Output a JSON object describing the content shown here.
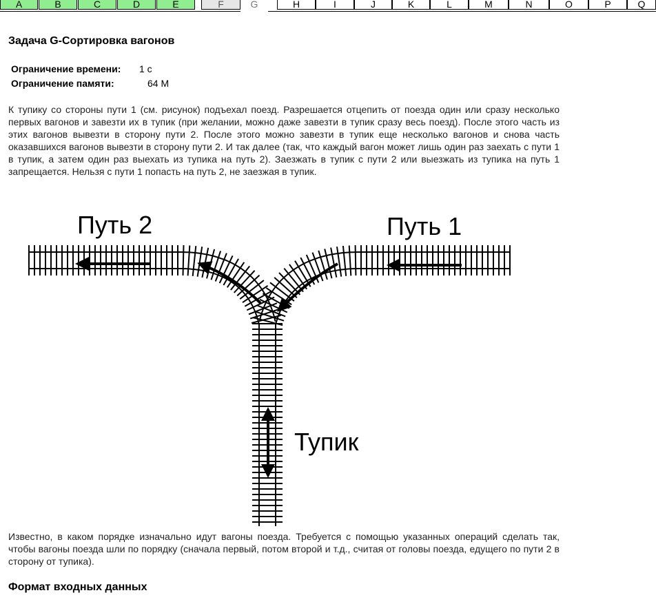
{
  "tabs": [
    {
      "label": "A",
      "state": "solved"
    },
    {
      "label": "B",
      "state": "solved"
    },
    {
      "label": "C",
      "state": "solved"
    },
    {
      "label": "D",
      "state": "solved"
    },
    {
      "label": "E",
      "state": "solved"
    },
    {
      "label": "F",
      "state": "neutral"
    },
    {
      "label": "G",
      "state": "active"
    },
    {
      "label": "H",
      "state": "plain"
    },
    {
      "label": "I",
      "state": "plain"
    },
    {
      "label": "J",
      "state": "plain"
    },
    {
      "label": "K",
      "state": "plain"
    },
    {
      "label": "L",
      "state": "plain"
    },
    {
      "label": "M",
      "state": "plain"
    },
    {
      "label": "N",
      "state": "plain"
    },
    {
      "label": "O",
      "state": "plain"
    },
    {
      "label": "P",
      "state": "plain"
    },
    {
      "label": "Q",
      "state": "plain"
    }
  ],
  "problem": {
    "title": "Задача G-Сортировка вагонов",
    "time_label": "Ограничение времени:",
    "time_value": "1 с",
    "memory_label": "Ограничение памяти:",
    "memory_value": "64 M",
    "statement": "К тупику со стороны пути 1 (см. рисунок) подъехал поезд. Разрешается отцепить от поезда один или сразу несколько первых вагонов и завезти их в тупик (при желании, можно даже завезти в тупик сразу весь поезд). После этого часть из этих вагонов вывезти в сторону пути 2. После этого можно завезти в тупик еще несколько вагонов и снова часть оказавшихся вагонов вывезти в сторону пути 2. И так далее (так, что каждый вагон может лишь один раз заехать с пути 1 в тупик, а затем один раз выехать из тупика на путь 2). Заезжать в тупик с пути 2 или выезжать из тупика на путь 1 запрещается. Нельзя с пути 1 попасть на путь 2, не заезжая в тупик.",
    "statement2": "Известно, в каком порядке изначально идут вагоны поезда. Требуется с помощью указанных операций сделать так, чтобы вагоны поезда шли по порядку (сначала первый, потом второй и т.д., считая от головы поезда, едущего по пути 2 в сторону от тупика).",
    "input_heading": "Формат входных данных"
  },
  "figure": {
    "label_path2": "Путь 2",
    "label_path1": "Путь 1",
    "label_deadend": "Тупик"
  }
}
